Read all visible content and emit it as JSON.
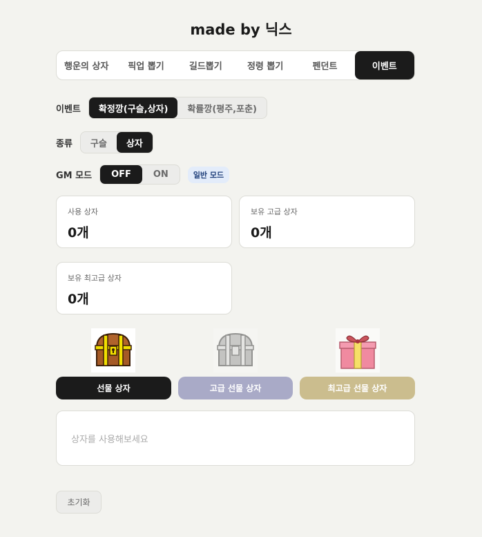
{
  "title": "made by 닉스",
  "tabs": [
    {
      "label": "행운의 상자"
    },
    {
      "label": "픽업 뽑기"
    },
    {
      "label": "길드뽑기"
    },
    {
      "label": "정령 뽑기"
    },
    {
      "label": "펜던트"
    },
    {
      "label": "이벤트",
      "active": true
    }
  ],
  "event_row": {
    "label": "이벤트",
    "options": [
      "확정깡(구슬,상자)",
      "확률깡(평주,포춘)"
    ],
    "selected": "확정깡(구슬,상자)"
  },
  "type_row": {
    "label": "종류",
    "options": [
      "구슬",
      "상자"
    ],
    "selected": "상자"
  },
  "gm_row": {
    "label": "GM 모드",
    "options": [
      "OFF",
      "ON"
    ],
    "selected": "OFF",
    "mode_badge": "일반 모드"
  },
  "stats": {
    "used": {
      "label": "사용 상자",
      "value": "0개"
    },
    "owned_premium": {
      "label": "보유 고급 상자",
      "value": "0개"
    },
    "owned_top": {
      "label": "보유 최고급 상자",
      "value": "0개"
    }
  },
  "boxes": {
    "gift": {
      "label": "선물 상자",
      "color": "#1b1b1b"
    },
    "premium": {
      "label": "고급 선물 상자",
      "color": "#a9aac7"
    },
    "top": {
      "label": "최고급 선물 상자",
      "color": "#cbbd8e"
    }
  },
  "log": {
    "placeholder": "상자를 사용해보세요"
  },
  "reset_label": "초기화"
}
